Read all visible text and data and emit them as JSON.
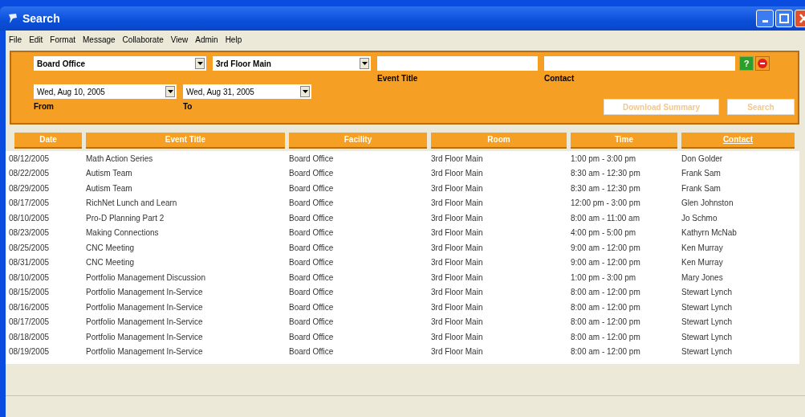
{
  "window": {
    "title": "Search"
  },
  "menu": [
    "File",
    "Edit",
    "Format",
    "Message",
    "Collaborate",
    "View",
    "Admin",
    "Help"
  ],
  "filters": {
    "facility": "Board Office",
    "room": "3rd Floor Main",
    "from_date": "Wed, Aug 10, 2005",
    "to_date": "Wed, Aug 31, 2005",
    "from_label": "From",
    "to_label": "To",
    "event_title_label": "Event Title",
    "contact_label": "Contact",
    "help_button": "?",
    "buttons": [
      {
        "label": "Download Summary",
        "disabled": true
      },
      {
        "label": "Search",
        "disabled": true
      }
    ]
  },
  "table": {
    "columns": [
      {
        "label": "Date",
        "sorted": false
      },
      {
        "label": "Event Title",
        "sorted": false
      },
      {
        "label": "Facility",
        "sorted": false
      },
      {
        "label": "Room",
        "sorted": false
      },
      {
        "label": "Time",
        "sorted": false
      },
      {
        "label": "Contact",
        "sorted": true
      }
    ],
    "rows": [
      [
        "08/12/2005",
        "Math Action Series",
        "Board Office",
        "3rd Floor Main",
        "1:00 pm - 3:00 pm",
        "Don Golder"
      ],
      [
        "08/22/2005",
        "Autism Team",
        "Board Office",
        "3rd Floor Main",
        "8:30 am - 12:30 pm",
        "Frank Sam"
      ],
      [
        "08/29/2005",
        "Autism Team",
        "Board Office",
        "3rd Floor Main",
        "8:30 am - 12:30 pm",
        "Frank Sam"
      ],
      [
        "08/17/2005",
        "RichNet Lunch and Learn",
        "Board Office",
        "3rd Floor Main",
        "12:00 pm - 3:00 pm",
        "Glen Johnston"
      ],
      [
        "08/10/2005",
        "Pro-D Planning Part 2",
        "Board Office",
        "3rd Floor Main",
        "8:00 am - 11:00 am",
        "Jo Schmo"
      ],
      [
        "08/23/2005",
        "Making Connections",
        "Board Office",
        "3rd Floor Main",
        "4:00 pm - 5:00 pm",
        "Kathyrn McNab"
      ],
      [
        "08/25/2005",
        "CNC Meeting",
        "Board Office",
        "3rd Floor Main",
        "9:00 am - 12:00 pm",
        "Ken Murray"
      ],
      [
        "08/31/2005",
        "CNC Meeting",
        "Board Office",
        "3rd Floor Main",
        "9:00 am - 12:00 pm",
        "Ken Murray"
      ],
      [
        "08/10/2005",
        "Portfolio Management Discussion",
        "Board Office",
        "3rd Floor Main",
        "1:00 pm - 3:00 pm",
        "Mary Jones"
      ],
      [
        "08/15/2005",
        "Portfolio Management In-Service",
        "Board Office",
        "3rd Floor Main",
        "8:00 am - 12:00 pm",
        "Stewart Lynch"
      ],
      [
        "08/16/2005",
        "Portfolio Management In-Service",
        "Board Office",
        "3rd Floor Main",
        "8:00 am - 12:00 pm",
        "Stewart Lynch"
      ],
      [
        "08/17/2005",
        "Portfolio Management In-Service",
        "Board Office",
        "3rd Floor Main",
        "8:00 am - 12:00 pm",
        "Stewart Lynch"
      ],
      [
        "08/18/2005",
        "Portfolio Management In-Service",
        "Board Office",
        "3rd Floor Main",
        "8:00 am - 12:00 pm",
        "Stewart Lynch"
      ],
      [
        "08/19/2005",
        "Portfolio Management In-Service",
        "Board Office",
        "3rd Floor Main",
        "8:00 am - 12:00 pm",
        "Stewart Lynch"
      ]
    ]
  }
}
